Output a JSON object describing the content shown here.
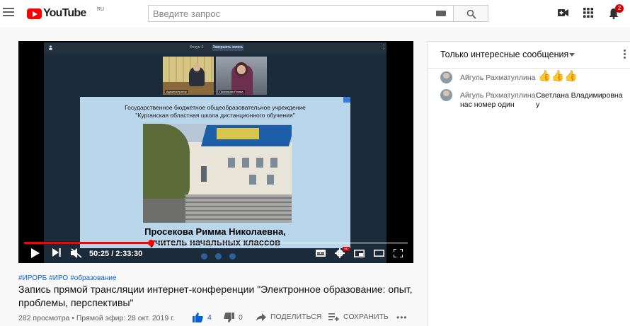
{
  "header": {
    "logo_text": "YouTube",
    "logo_region": "RU",
    "search_placeholder": "Введите запрос",
    "notification_count": "2"
  },
  "player": {
    "conference_label": "Форум 2",
    "conference_button": "Завершить запись",
    "participant_1": "Администратор",
    "participant_2": "Просекова Римма",
    "slide": {
      "line1": "Государственное бюджетное общеобразовательное учреждение",
      "line2": "\"Курганская областная школа дистанционного обучения\"",
      "name": "Просекова Римма Николаевна,",
      "role": "учитель начальных классов"
    },
    "time": "50:25 / 2:33:30",
    "progress_fraction": 0.33,
    "hd_label": "HD"
  },
  "video": {
    "hashtags": [
      "#ИРОРБ",
      "#ИРО",
      "#образование"
    ],
    "title": "Запись прямой трансляции интернет-конференции \"Электронное образование: опыт, проблемы, перспективы\"",
    "stats": "282 просмотра • Прямой эфир: 28 окт. 2019 г.",
    "likes": "4",
    "dislikes": "0",
    "share_label": "ПОДЕЛИТЬСЯ",
    "save_label": "СОХРАНИТЬ"
  },
  "chat": {
    "title": "Только интересные сообщения",
    "messages": [
      {
        "author": "Айгуль Рахматуллина",
        "text": "👍👍👍"
      },
      {
        "author": "Айгуль Рахматуллина",
        "text_line1": "Светлана Владимировна у",
        "text_line2": "нас номер один"
      }
    ]
  },
  "colors": {
    "brand_red": "#ff0000",
    "link_blue": "#065fd4",
    "badge_red": "#cc0000"
  }
}
